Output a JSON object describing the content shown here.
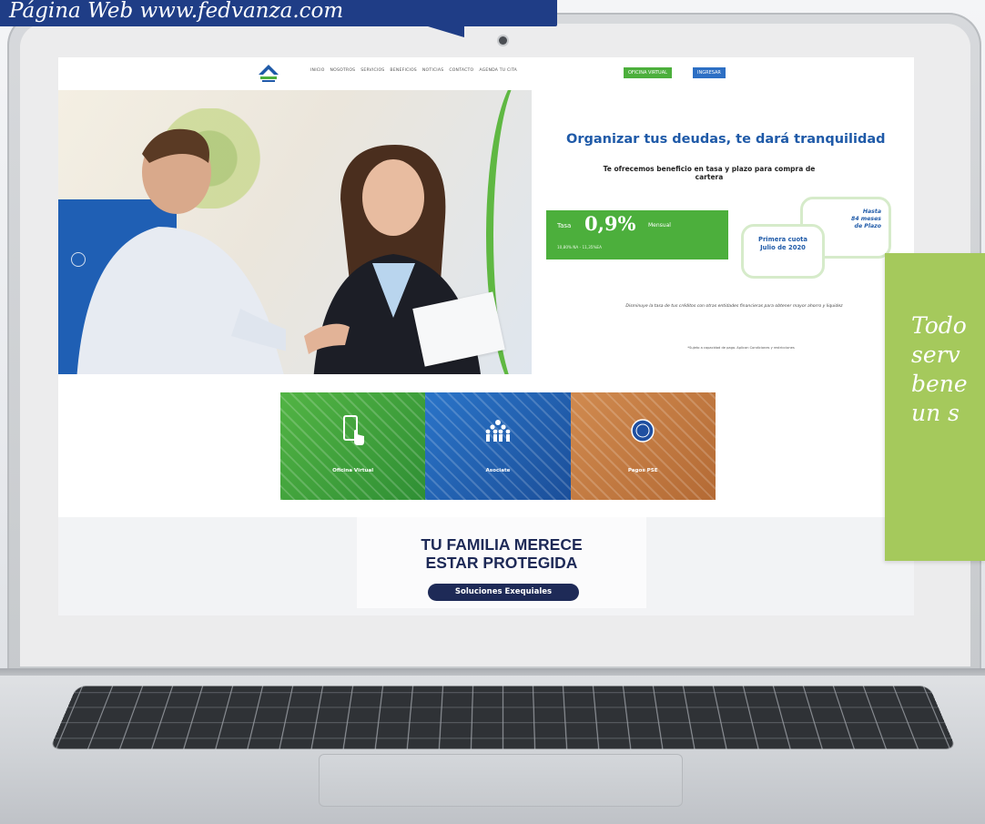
{
  "caption": {
    "text": "Página Web www.fedvanza.com"
  },
  "site": {
    "nav": {
      "items": [
        "INICIO",
        "NOSOTROS",
        "SERVICIOS",
        "BENEFICIOS",
        "NOTICIAS",
        "CONTACTO",
        "AGENDA TU CITA"
      ],
      "btn_oficina": "OFICINA VIRTUAL",
      "btn_ingresar": "INGRESAR"
    },
    "hero": {
      "title": "Organizar tus deudas, te dará tranquilidad",
      "subtitle": "Te ofrecemos beneficio en tasa y plazo para compra de cartera",
      "rate_label": "Tasa",
      "rate_value": "0,9%",
      "rate_unit": "Mensual",
      "rate_ea": "10,80% NA - 11,35%EA",
      "bubble_plazo": "Hasta\n84 meses\nde Plazo",
      "bubble_cuota": "Primera cuota\nJulio de 2020",
      "note": "Disminuye la tasa de tus créditos con otras entidades financieras para obtener mayor ahorro y liquidez",
      "fine_print": "*Sujeto a capacidad de pago. Aplican Condiciones y restricciones"
    },
    "tiles": [
      {
        "label": "Oficina Virtual",
        "color": "#4caf3c",
        "icon": "phone-touch-icon"
      },
      {
        "label": "Asociate",
        "color": "#2a6fc2",
        "icon": "people-group-icon"
      },
      {
        "label": "Pagos PSE",
        "color": "#c98046",
        "icon": "pse-icon"
      }
    ],
    "promo": {
      "title_line1": "TU FAMILIA MERECE",
      "title_line2": "ESTAR PROTEGIDA",
      "button": "Soluciones Exequiales"
    }
  },
  "side_note": {
    "text": "Todo\nserv\nbene\nun s"
  },
  "colors": {
    "brand_blue": "#1f5aa8",
    "brand_green": "#4caf3c",
    "navy": "#1e2a57",
    "note_green": "#a5c95c"
  }
}
